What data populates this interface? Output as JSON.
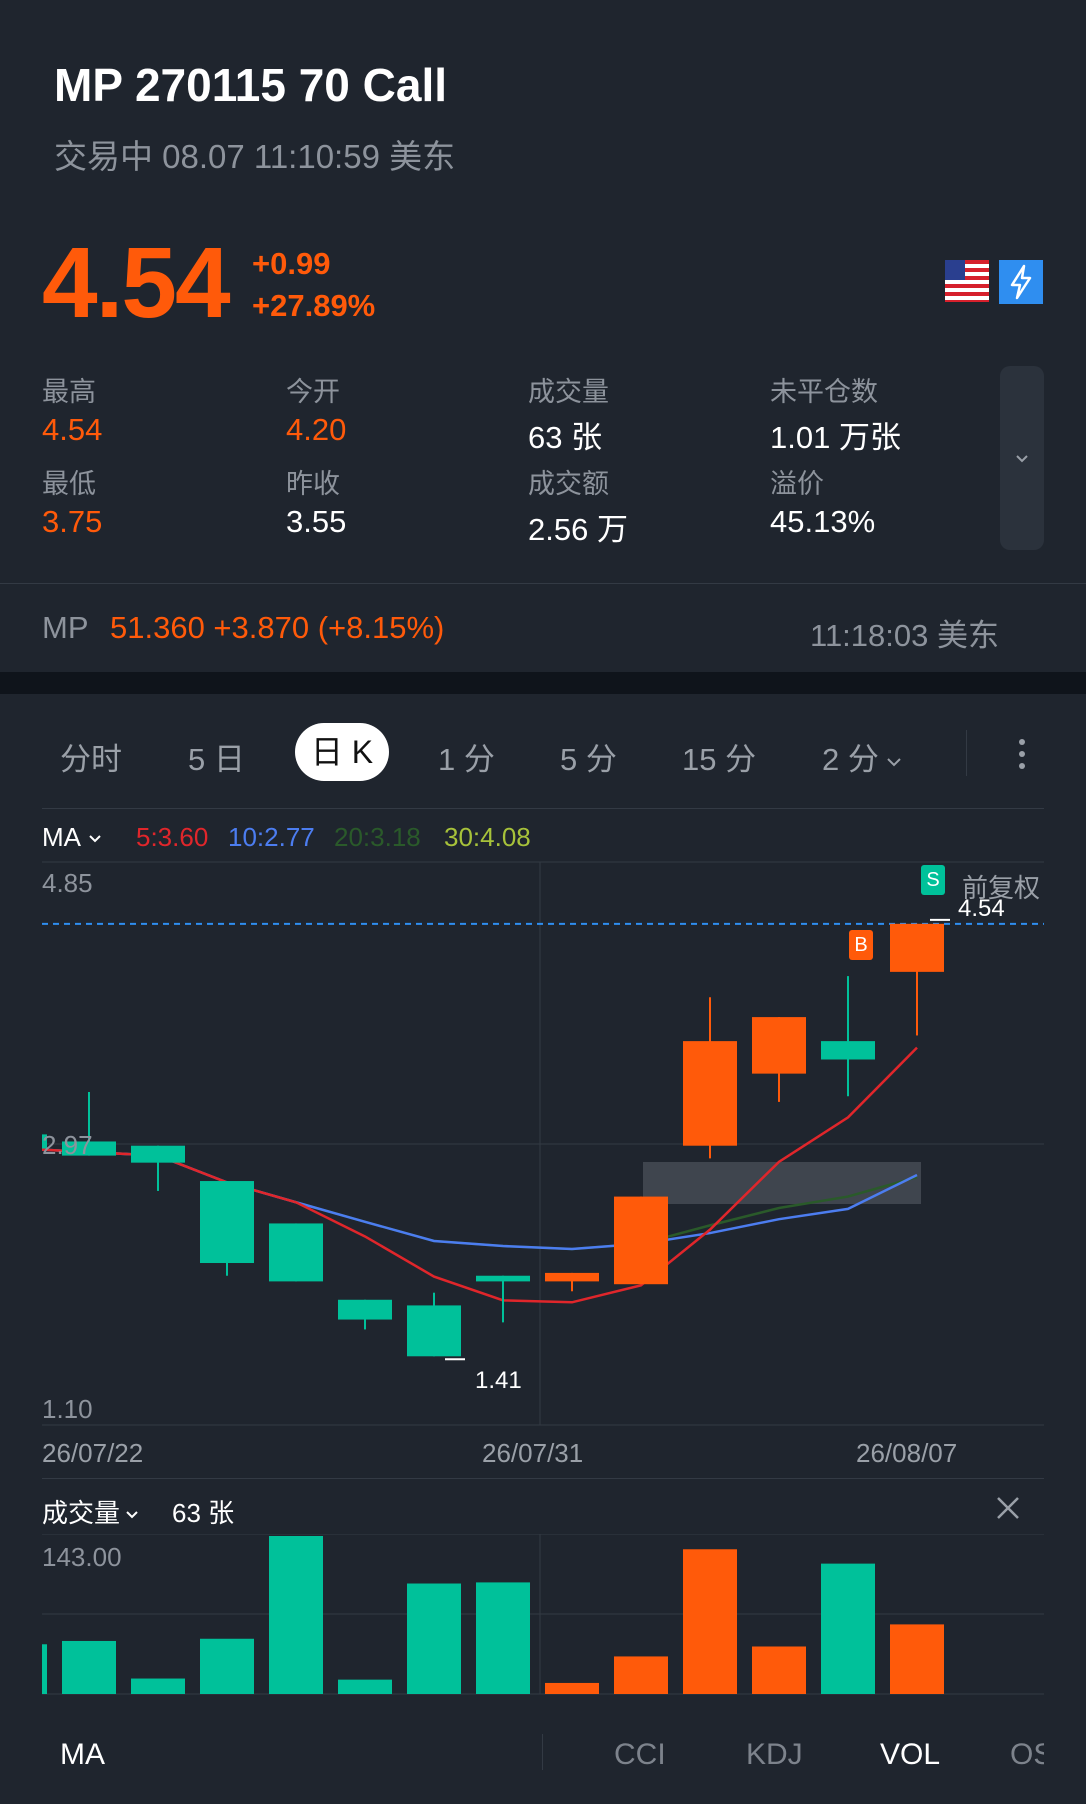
{
  "header": {
    "title": "MP 270115 70 Call",
    "status": "交易中 08.07 11:10:59 美东",
    "price": "4.54",
    "change": "+0.99",
    "change_pct": "+27.89%"
  },
  "stats": {
    "high_label": "最高",
    "high": "4.54",
    "open_label": "今开",
    "open": "4.20",
    "volume_label": "成交量",
    "volume": "63 张",
    "oi_label": "未平仓数",
    "oi": "1.01 万张",
    "low_label": "最低",
    "low": "3.75",
    "prev_label": "昨收",
    "prev": "3.55",
    "turnover_label": "成交额",
    "turnover": "2.56 万",
    "premium_label": "溢价",
    "premium": "45.13%"
  },
  "underlying": {
    "symbol": "MP",
    "quote": "51.360  +3.870  (+8.15%)",
    "time": "11:18:03 美东"
  },
  "tabs": {
    "t1": "分时",
    "t2": "5 日",
    "t3": "日 K",
    "t4": "1 分",
    "t5": "5 分",
    "t6": "15 分",
    "t7": "2 分"
  },
  "ma": {
    "label": "MA",
    "ma5": "5:3.60",
    "ma10": "10:2.77",
    "ma20": "20:3.18",
    "ma30": "30:4.08",
    "adjust": "前复权"
  },
  "axis": {
    "top": "4.85",
    "mid": "2.97",
    "bottom": "1.10",
    "last_price": "4.54",
    "low_mark": "1.41",
    "d1": "26/07/22",
    "d2": "26/07/31",
    "d3": "26/08/07",
    "vol_max": "143.00"
  },
  "markers": {
    "buy": "B",
    "sell": "S"
  },
  "volume_section": {
    "label": "成交量",
    "value": "63 张"
  },
  "bottom_tabs": {
    "ma": "MA",
    "cci": "CCI",
    "kdj": "KDJ",
    "vol": "VOL",
    "os": "OS"
  },
  "colors": {
    "up": "#ff5a0a",
    "down": "#00c19a",
    "ma5": "#e0262b",
    "ma10": "#4c7df0",
    "ma20": "#2a5a2a",
    "ma30": "#a7c23a"
  },
  "chart_data": {
    "type": "candlestick",
    "ylim": [
      1.1,
      4.85
    ],
    "candles": [
      {
        "o": 3.05,
        "c": 2.95,
        "h": 3.25,
        "l": 2.95,
        "v": 45
      },
      {
        "o": 3.0,
        "c": 2.9,
        "h": 3.35,
        "l": 2.9,
        "v": 48
      },
      {
        "o": 2.97,
        "c": 2.85,
        "h": 2.97,
        "l": 2.65,
        "v": 14
      },
      {
        "o": 2.72,
        "c": 2.14,
        "h": 2.72,
        "l": 2.05,
        "v": 50
      },
      {
        "o": 2.42,
        "c": 2.01,
        "h": 2.42,
        "l": 2.01,
        "v": 143
      },
      {
        "o": 1.88,
        "c": 1.74,
        "h": 1.88,
        "l": 1.67,
        "v": 13
      },
      {
        "o": 1.84,
        "c": 1.48,
        "h": 1.93,
        "l": 1.48,
        "v": 100
      },
      {
        "o": 2.05,
        "c": 2.01,
        "h": 2.05,
        "l": 1.72,
        "v": 101
      },
      {
        "o": 2.01,
        "c": 2.07,
        "h": 2.07,
        "l": 1.94,
        "v": 10
      },
      {
        "o": 1.99,
        "c": 2.61,
        "h": 2.61,
        "l": 1.99,
        "v": 34
      },
      {
        "o": 2.97,
        "c": 3.71,
        "h": 4.02,
        "l": 2.88,
        "v": 131
      },
      {
        "o": 3.48,
        "c": 3.88,
        "h": 3.88,
        "l": 3.28,
        "v": 43
      },
      {
        "o": 3.71,
        "c": 3.58,
        "h": 4.17,
        "l": 3.32,
        "v": 118
      },
      {
        "o": 4.2,
        "c": 4.54,
        "h": 4.54,
        "l": 3.75,
        "v": 63
      }
    ]
  }
}
